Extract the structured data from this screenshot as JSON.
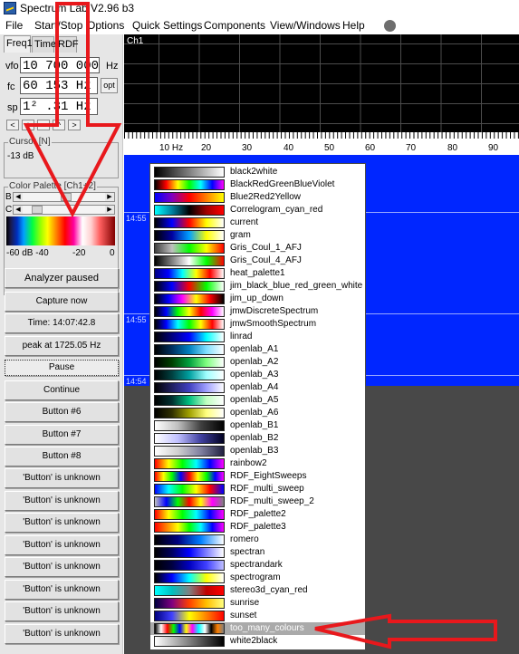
{
  "window": {
    "title": "Spectrum Lab V2.96 b3"
  },
  "menu": [
    "File",
    "Start/Stop",
    "Options",
    "Quick Settings",
    "Components",
    "View/Windows",
    "Help"
  ],
  "tabs": [
    "Freq1",
    "Time",
    "RDF"
  ],
  "left": {
    "vfo_label": "vfo",
    "vfo_value": "10 700 000",
    "vfo_unit": "Hz",
    "fc_label": "fc",
    "fc_value": "60 153 Hz",
    "opt_label": "opt",
    "sp_label": "sp",
    "sp_value": "1² .31 Hz",
    "step_buttons": [
      "<",
      "+",
      "-",
      "^",
      ">"
    ],
    "cursor_title": "Cursor [N]",
    "cursor_value": "-13 dB",
    "palette_title": "Color Palette [Ch1+2]",
    "palette_b": "B",
    "palette_c": "C",
    "palette_ticks": [
      "-60 dB -40",
      "-20",
      "0"
    ],
    "buttons": [
      "Analyzer paused",
      "Capture now",
      "Time:  14:07:42.8",
      "peak at 1725.05 Hz",
      "Pause",
      "Continue",
      "Button #6",
      "Button #7",
      "Button #8",
      "'Button' is unknown",
      "'Button' is unknown",
      "'Button' is unknown",
      "'Button' is unknown",
      "'Button' is unknown",
      "'Button' is unknown",
      "'Button' is unknown",
      "'Button' is unknown"
    ]
  },
  "spectrum": {
    "channel": "Ch1",
    "freq_ticks": [
      "10 Hz",
      "20",
      "30",
      "40",
      "50",
      "60",
      "70",
      "80",
      "90"
    ],
    "timestamps": [
      "14:55",
      "14:55",
      "14:54"
    ]
  },
  "palettes": [
    {
      "name": "black2white",
      "colors": [
        "#000000",
        "#ffffff"
      ]
    },
    {
      "name": "BlackRedGreenBlueViolet",
      "colors": [
        "#000000",
        "#ff0000",
        "#ffff00",
        "#00ff00",
        "#00ffff",
        "#0000ff",
        "#ff00ff"
      ]
    },
    {
      "name": "Blue2Red2Yellow",
      "colors": [
        "#0000ff",
        "#8000c0",
        "#ff0000",
        "#ff8000",
        "#ffff00"
      ]
    },
    {
      "name": "Correlogram_cyan_red",
      "colors": [
        "#00ffff",
        "#0080a0",
        "#000000",
        "#a00000",
        "#ff0000"
      ]
    },
    {
      "name": "current",
      "colors": [
        "#000000",
        "#0000ff",
        "#ff0000",
        "#ffff00",
        "#ffffff"
      ]
    },
    {
      "name": "gram",
      "colors": [
        "#000000",
        "#0000a0",
        "#00a0ff",
        "#ffff00",
        "#ffffff"
      ]
    },
    {
      "name": "Gris_Coul_1_AFJ",
      "colors": [
        "#404040",
        "#c0c0c0",
        "#00ff00",
        "#ffff00",
        "#ff0000"
      ]
    },
    {
      "name": "Gris_Coul_4_AFJ",
      "colors": [
        "#000000",
        "#808080",
        "#ffffff",
        "#00ff00",
        "#ff0000"
      ]
    },
    {
      "name": "heat_palette1",
      "colors": [
        "#000080",
        "#0000ff",
        "#00ffff",
        "#ffff00",
        "#ff0000",
        "#ffffff"
      ]
    },
    {
      "name": "jim_black_blue_red_green_white",
      "colors": [
        "#000000",
        "#0000ff",
        "#ff0000",
        "#00ff00",
        "#ffffff"
      ]
    },
    {
      "name": "jim_up_down",
      "colors": [
        "#000000",
        "#0000ff",
        "#ff00ff",
        "#ffff00",
        "#ff0000",
        "#000000"
      ]
    },
    {
      "name": "jmwDiscreteSpectrum",
      "colors": [
        "#000000",
        "#0000ff",
        "#00ff00",
        "#ffff00",
        "#ff0000",
        "#ff00ff",
        "#ffffff"
      ]
    },
    {
      "name": "jmwSmoothSpectrum",
      "colors": [
        "#000000",
        "#0000ff",
        "#00ffff",
        "#00ff00",
        "#ffff00",
        "#ff0000",
        "#ffffff"
      ]
    },
    {
      "name": "linrad",
      "colors": [
        "#000000",
        "#000080",
        "#0000ff",
        "#00ffff",
        "#ffffff"
      ]
    },
    {
      "name": "openlab_A1",
      "colors": [
        "#000000",
        "#003060",
        "#0080c0",
        "#80e0ff",
        "#ffffff"
      ]
    },
    {
      "name": "openlab_A2",
      "colors": [
        "#000000",
        "#004000",
        "#00a040",
        "#80ff80",
        "#ffffff"
      ]
    },
    {
      "name": "openlab_A3",
      "colors": [
        "#000000",
        "#004040",
        "#00a0a0",
        "#a0ffff",
        "#ffffff"
      ]
    },
    {
      "name": "openlab_A4",
      "colors": [
        "#000000",
        "#202060",
        "#4040c0",
        "#a0a0ff",
        "#ffffff"
      ]
    },
    {
      "name": "openlab_A5",
      "colors": [
        "#000000",
        "#003030",
        "#00c080",
        "#c0ffc0",
        "#ffffff"
      ]
    },
    {
      "name": "openlab_A6",
      "colors": [
        "#000000",
        "#303000",
        "#a0a000",
        "#ffff80",
        "#ffffff"
      ]
    },
    {
      "name": "openlab_B1",
      "colors": [
        "#ffffff",
        "#c0c0c0",
        "#404040",
        "#000000"
      ]
    },
    {
      "name": "openlab_B2",
      "colors": [
        "#ffffff",
        "#c0c0ff",
        "#4040a0",
        "#000020"
      ]
    },
    {
      "name": "openlab_B3",
      "colors": [
        "#ffffff",
        "#d0d0d0",
        "#8080a0",
        "#202040"
      ]
    },
    {
      "name": "rainbow2",
      "colors": [
        "#ff0000",
        "#ffff00",
        "#00ff00",
        "#00ffff",
        "#0000ff",
        "#ff00ff"
      ]
    },
    {
      "name": "RDF_EightSweeps",
      "colors": [
        "#ff0000",
        "#ffff00",
        "#00ff00",
        "#0000ff",
        "#ff0000",
        "#ffff00",
        "#00ff00",
        "#0000ff",
        "#ff00ff"
      ]
    },
    {
      "name": "RDF_multi_sweep",
      "colors": [
        "#0000ff",
        "#00ffff",
        "#00ff00",
        "#ffff00",
        "#ff0000",
        "#0000ff"
      ]
    },
    {
      "name": "RDF_multi_sweep_2",
      "colors": [
        "#c0c0c0",
        "#0000ff",
        "#00ff00",
        "#ff0000",
        "#ffff00",
        "#ff00ff",
        "#808080"
      ]
    },
    {
      "name": "RDF_palette2",
      "colors": [
        "#ff0000",
        "#ffff00",
        "#00ff00",
        "#00ffff",
        "#0000ff",
        "#ff00ff"
      ]
    },
    {
      "name": "RDF_palette3",
      "colors": [
        "#ff0000",
        "#ff8000",
        "#ffff00",
        "#00ff00",
        "#00ffff",
        "#0000ff",
        "#ff00ff"
      ]
    },
    {
      "name": "romero",
      "colors": [
        "#000000",
        "#000080",
        "#0080ff",
        "#ffffff"
      ]
    },
    {
      "name": "spectran",
      "colors": [
        "#000000",
        "#000060",
        "#0000ff",
        "#8080ff",
        "#ffffff"
      ]
    },
    {
      "name": "spectrandark",
      "colors": [
        "#000000",
        "#000040",
        "#0000c0",
        "#4040ff",
        "#c0c0ff"
      ]
    },
    {
      "name": "spectrogram",
      "colors": [
        "#000000",
        "#0000ff",
        "#00ffff",
        "#ffff00",
        "#ffffff"
      ]
    },
    {
      "name": "stereo3d_cyan_red",
      "colors": [
        "#00ffff",
        "#00c0c0",
        "#808080",
        "#c00000",
        "#ff0000"
      ]
    },
    {
      "name": "sunrise",
      "colors": [
        "#000040",
        "#800080",
        "#ff4000",
        "#ffc000",
        "#ffff80"
      ]
    },
    {
      "name": "sunset",
      "colors": [
        "#000080",
        "#4040ff",
        "#ffff00",
        "#ff8000",
        "#ff0000"
      ]
    },
    {
      "name": "too_many_colours",
      "colors": [
        "#000000",
        "#ffffff",
        "#ff0000",
        "#00ff00",
        "#0000ff",
        "#ffff00",
        "#ff00ff",
        "#00ffff",
        "#ffffff",
        "#000000",
        "#ff8000",
        "#808080"
      ],
      "selected": true
    },
    {
      "name": "white2black",
      "colors": [
        "#ffffff",
        "#000000"
      ]
    }
  ]
}
